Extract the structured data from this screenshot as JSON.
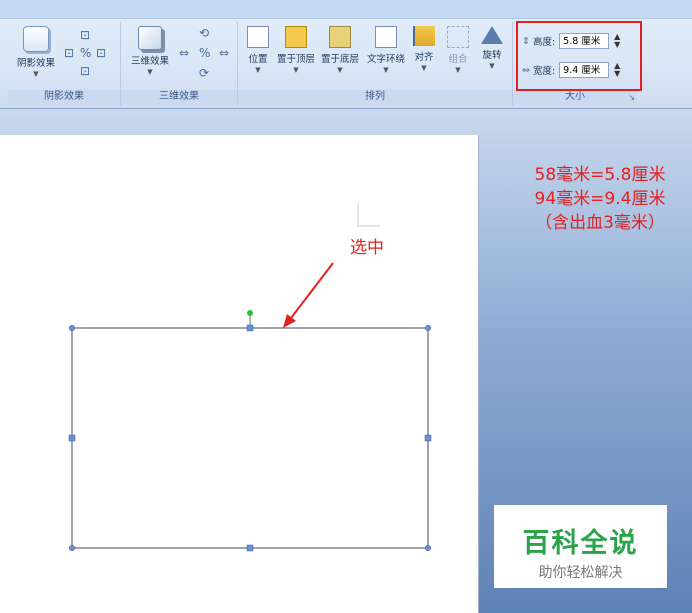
{
  "ribbon": {
    "shadow_group": {
      "button": "阴影效果",
      "label": "阴影效果"
    },
    "threed_group": {
      "button": "三维效果",
      "label": "三维效果"
    },
    "arrange_group": {
      "buttons": [
        "位置",
        "置于顶层",
        "置于底层",
        "文字环绕",
        "对齐",
        "组合",
        "旋转"
      ],
      "label": "排列"
    },
    "size_group": {
      "height_label": "高度:",
      "height_value": "5.8 厘米",
      "width_label": "宽度:",
      "width_value": "9.4 厘米",
      "label": "大小"
    }
  },
  "annotations": {
    "line1": "58毫米=5.8厘米",
    "line2": "94毫米=9.4厘米",
    "line3": "（含出血3毫米）",
    "selected_label": "选中"
  },
  "watermark": {
    "title": "百科全说",
    "subtitle": "助你轻松解决"
  },
  "colors": {
    "annotation_red": "#e42020",
    "watermark_green": "#2aa34a"
  }
}
